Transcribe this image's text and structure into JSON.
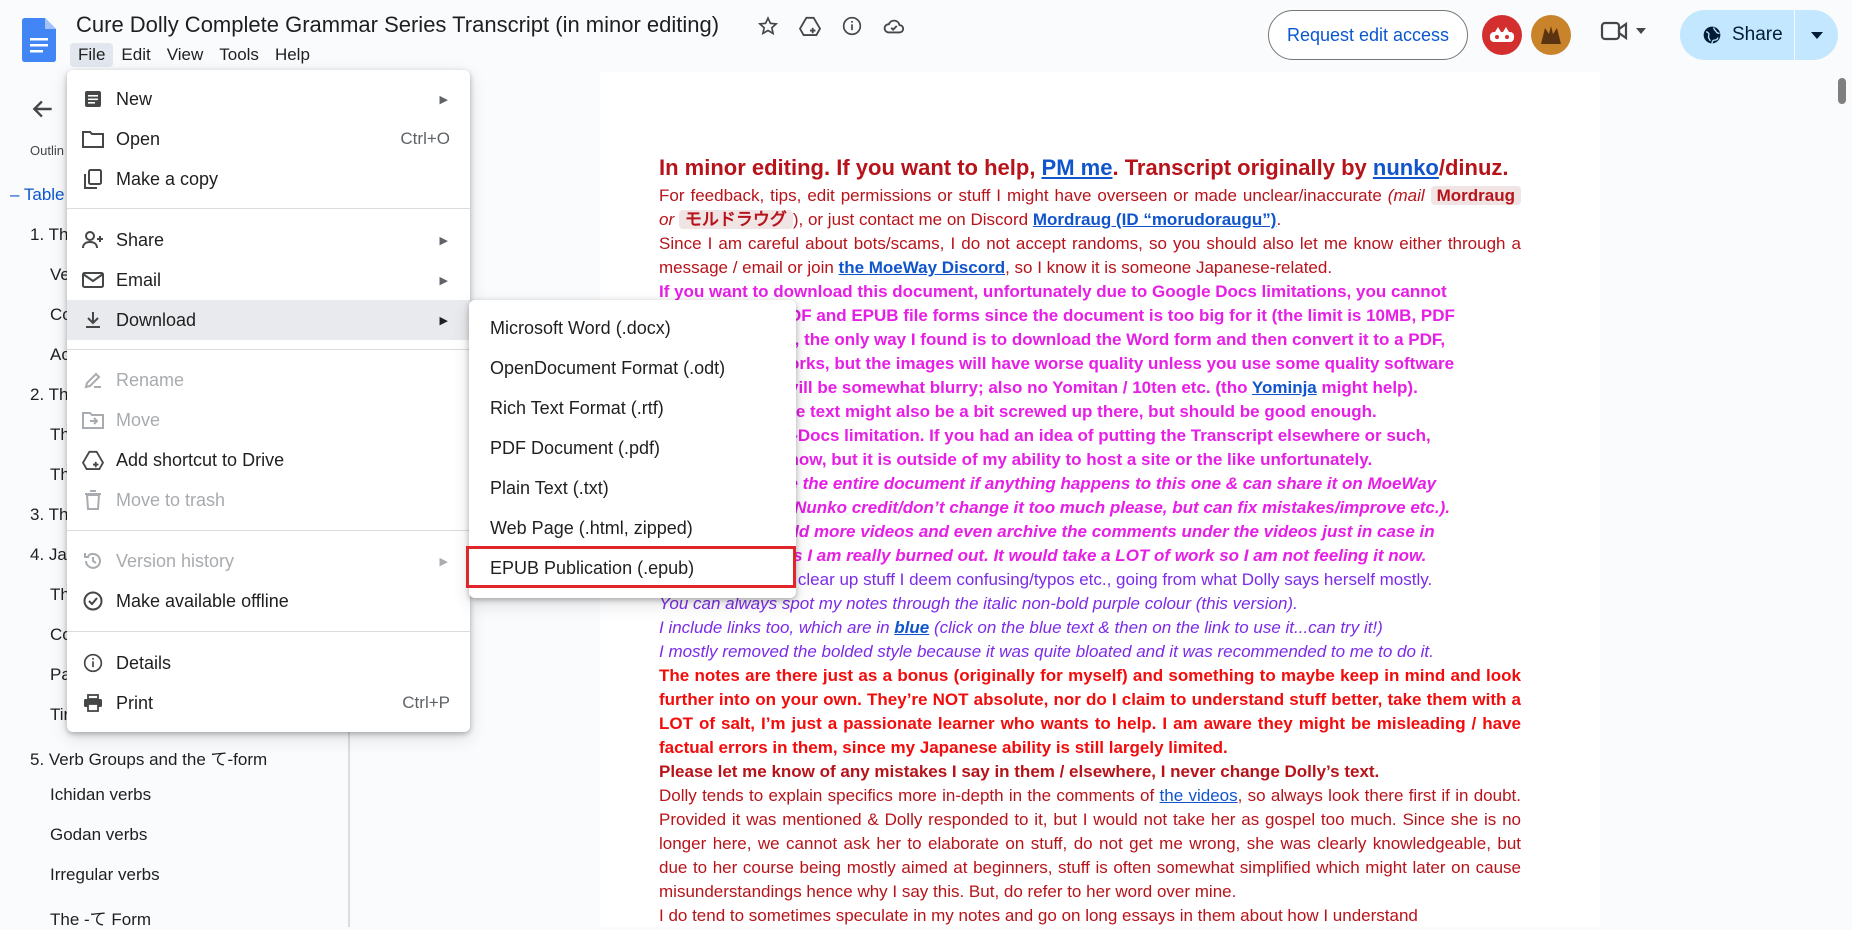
{
  "header": {
    "title": "Cure Dolly Complete Grammar Series Transcript (in minor editing)",
    "menu": [
      "File",
      "Edit",
      "View",
      "Tools",
      "Help"
    ],
    "request_edit": "Request edit access",
    "share": "Share"
  },
  "sidebar": {
    "outline_label": "Outlin",
    "toc_head": "– Table",
    "items": [
      "1. Th",
      "Ve",
      "Co",
      "Ac",
      "2. Th",
      "Th",
      "Th",
      "3. Th",
      "4. Ja",
      "Th",
      "Co",
      "Pa",
      "Tir",
      "5. Verb Groups and the て-form",
      "Ichidan verbs",
      "Godan verbs",
      "Irregular verbs",
      "The -て Form"
    ]
  },
  "file_menu": {
    "items": [
      {
        "label": "New",
        "icon": "new-doc-icon"
      },
      {
        "label": "Open",
        "icon": "folder-icon",
        "shortcut": "Ctrl+O"
      },
      {
        "label": "Make a copy",
        "icon": "copy-icon"
      },
      {
        "label": "Share",
        "icon": "share-person-icon"
      },
      {
        "label": "Email",
        "icon": "email-icon"
      },
      {
        "label": "Download",
        "icon": "download-icon"
      },
      {
        "label": "Rename",
        "icon": "rename-icon"
      },
      {
        "label": "Move",
        "icon": "move-icon"
      },
      {
        "label": "Add shortcut to Drive",
        "icon": "drive-shortcut-icon"
      },
      {
        "label": "Move to trash",
        "icon": "trash-icon"
      },
      {
        "label": "Version history",
        "icon": "history-icon"
      },
      {
        "label": "Make available offline",
        "icon": "offline-icon"
      },
      {
        "label": "Details",
        "icon": "info-icon"
      },
      {
        "label": "Print",
        "icon": "print-icon",
        "shortcut": "Ctrl+P"
      }
    ]
  },
  "download_menu": {
    "items": [
      "Microsoft Word (.docx)",
      "OpenDocument Format (.odt)",
      "Rich Text Format (.rtf)",
      "PDF Document (.pdf)",
      "Plain Text (.txt)",
      "Web Page (.html, zipped)",
      "EPUB Publication (.epub)"
    ],
    "highlighted": "EPUB Publication (.epub)"
  },
  "document": {
    "l1a": "In minor editing. If you want to help, ",
    "l1b": "PM me",
    "l1c": ". Transcript originally by ",
    "l1d": "nunko",
    "l1e": "/dinuz.",
    "p2a": "For feedback, tips, edit permissions or stuff I might have overseen or made unclear/inaccurate ",
    "p2b": "(mail ",
    "p2c": "Mordraug",
    "p2d": " or ",
    "p2e": "モルドラウグ",
    "p2f": "), or just contact me on Discord ",
    "p2g": "Mordraug (ID “morudoraugu”)",
    "p2h": ".",
    "p3a": "Since I am careful about bots/scams, I do not accept randoms, so you should also let me know either through a message / email or join ",
    "p3b": "the MoeWay Discord",
    "p3c": ", so I know it is someone Japanese-related.",
    "p4a": "If you want to download this document, unfortunately due to Google Docs limitations, you cannot",
    "p4b": "DF and EPUB file forms since the document is too big for it (the limit is 10MB, PDF",
    "p4c": "), the only way I found is to download the Word form and then convert it to a PDF,",
    "p4d": "orks, but the images will have worse quality unless you use some quality software",
    "p4e": "vill be somewhat blurry; also no Yomitan / 10ten etc. (tho ",
    "p4f": "Yominja",
    "p4g": " might help).",
    "p4h": "of the text might also be a bit screwed up there, but should be good enough.",
    "p5a": "G-Docs limitation. If you had an idea of putting the Transcript elsewhere or such,",
    "p5b": "know, but it is outside of my ability to host a site or the like unfortunately.",
    "p6a": "ve the entire document if anything happens to this one & can share it on MoeWay",
    "p6b": "d Nunko credit/don’t change it too much please, but can fix mistakes/improve etc.).",
    "p6c": "add more videos and even archive the comments under the videos just in case in",
    "p6d": "las I am really burned out. It would take a LOT of work so I am not feeling it now.",
    "p7a": "to clear up stuff I deem confusing/typos etc., going from what Dolly says herself mostly.",
    "p7b": "You can always spot my notes through the italic non-bold purple colour (this version).",
    "p7c": "I include links too, which are in ",
    "p7d": "blue",
    "p7e": " (click on the blue text & then on the link to use it...can try it!)",
    "p7f": "I mostly removed the bolded style because it was quite bloated and it was recommended to me to do it.",
    "p8": "The notes are there just as a bonus (originally for myself) and something to maybe keep in mind and look further into on your own. They’re NOT absolute, nor do I claim to understand stuff better, take them with a LOT of salt, I’m just a passionate learner who wants to help. I am aware they might be misleading / have factual errors in them, since my Japanese ability is still largely limited.",
    "p9": "Please let me know of any mistakes I say in them / elsewhere, I never change Dolly’s text.",
    "p10a": "Dolly tends to explain specifics more in-depth in the comments of ",
    "p10b": "the videos",
    "p10c": ", so always look there first if in doubt. Provided it was mentioned & Dolly responded to it, but I would not take her as gospel too much. Since she is no longer here, we cannot ask her to elaborate on stuff, do not get me wrong, she was clearly knowledgeable, but due to her course being mostly aimed at beginners, stuff is often somewhat simplified which might later on cause misunderstandings hence why I say this. But, do refer to her word over mine.",
    "p11": "I do tend to sometimes speculate in my notes and go on long essays in them about how I understand"
  },
  "colors": {
    "accent": "#0b57d0",
    "highlight_box": "#e0262b",
    "doc_dark_red": "#b7131a",
    "doc_magenta": "#e61ee6",
    "doc_purple": "#7c2be8",
    "doc_red": "#f20c0c"
  }
}
